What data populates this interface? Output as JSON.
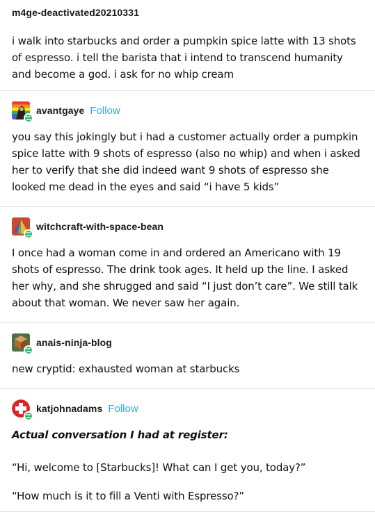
{
  "posts": [
    {
      "username": "m4ge-deactivated20210331",
      "text": "i walk into starbucks and order a pumpkin spice latte with 13 shots of espresso. i tell the barista that i intend to transcend humanity and become a god. i ask for no whip cream"
    },
    {
      "username": "avantgaye",
      "follow": "Follow",
      "text": "you say this jokingly but i had a customer actually order a pumpkin spice latte with 9 shots of espresso (also no whip) and when i asked her to verify that she did indeed want 9 shots of espresso she looked me dead in the eyes and said “i have 5 kids”"
    },
    {
      "username": "witchcraft-with-space-bean",
      "text": "I once had a woman come in and ordered an Americano with 19 shots of espresso. The drink took ages. It held up the line. I asked her why, and she shrugged and said “I just don’t care”. We still talk about that woman. We never saw her again."
    },
    {
      "username": "anais-ninja-blog",
      "text": "new cryptid: exhausted woman at starbucks"
    },
    {
      "username": "katjohnadams",
      "follow": "Follow",
      "heading": "Actual conversation I had at register:",
      "line1": "“Hi, welcome to [Starbucks]! What can I get you, today?”",
      "line2": "“How much is it to fill a Venti with Espresso?”"
    }
  ],
  "colors": {
    "follow": "#30a7f2",
    "reblog_badge": "#2fb86a",
    "divider": "#e3e3e3"
  },
  "icons": {
    "reblog": "reblog-icon",
    "avatar_avantgaye": "rainbow-avatar",
    "avatar_witchcraft": "pyramid-avatar",
    "avatar_anais": "cube-avatar",
    "avatar_katjohnadams": "red-cross-avatar"
  }
}
